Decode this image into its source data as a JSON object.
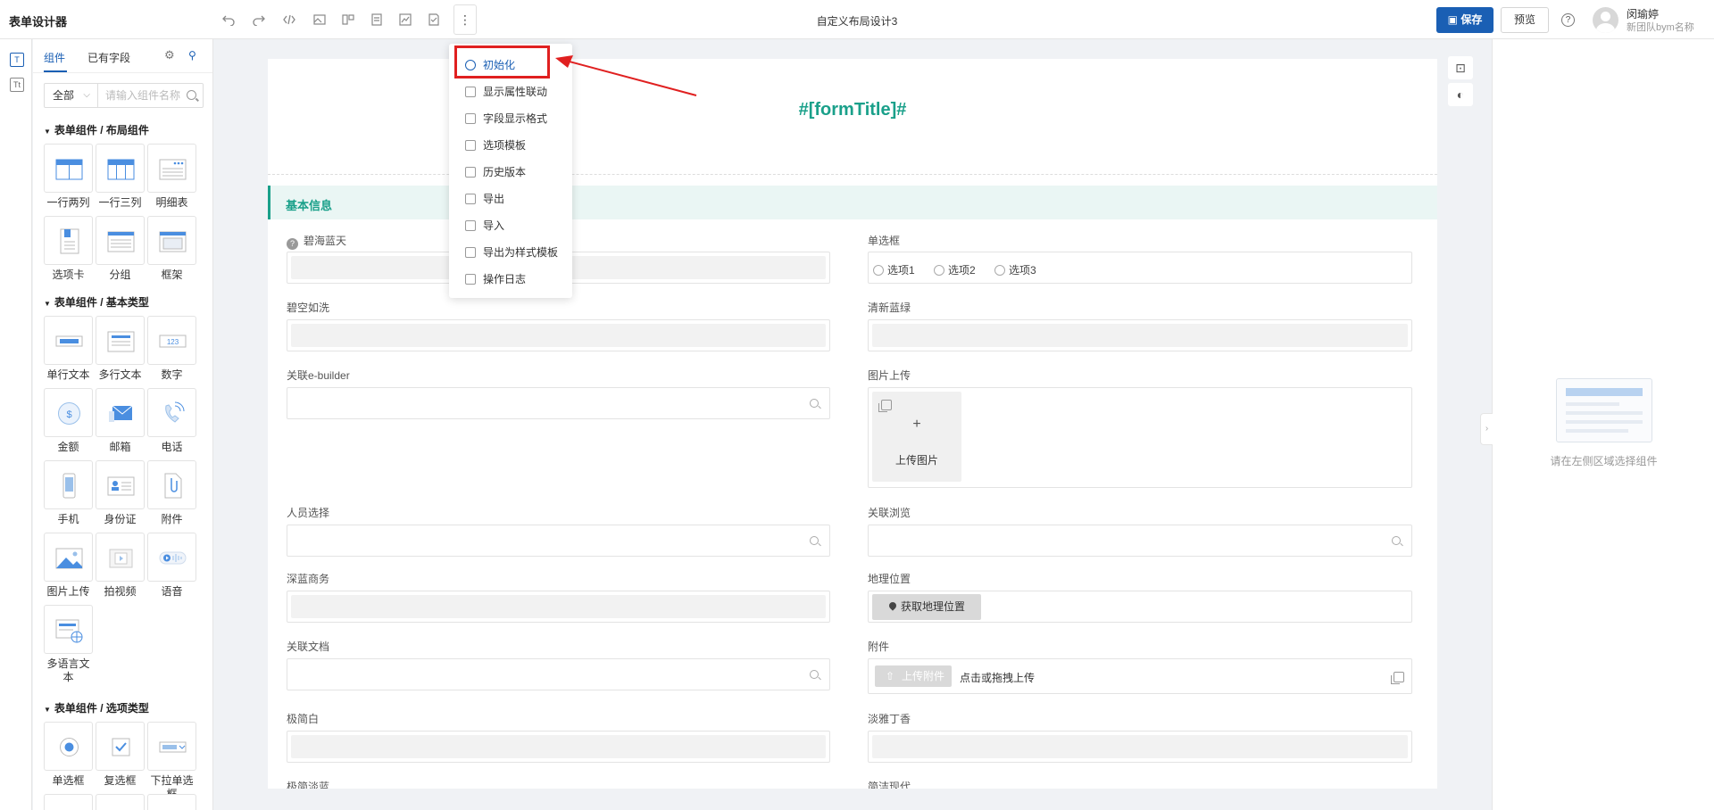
{
  "topbar": {
    "app_title": "表单设计器",
    "design_title": "自定义布局设计3",
    "save_label": "保存",
    "preview_label": "预览",
    "help": "?",
    "user_name": "闵瑜婷",
    "user_team": "新团队bym名称"
  },
  "sidebar": {
    "tab_components": "组件",
    "tab_fields": "已有字段",
    "filter_value": "全部",
    "search_placeholder": "请输入组件名称",
    "groups": [
      {
        "title": "表单组件 / 布局组件",
        "items": [
          "一行两列",
          "一行三列",
          "明细表",
          "选项卡",
          "分组",
          "框架"
        ]
      },
      {
        "title": "表单组件 / 基本类型",
        "items": [
          "单行文本",
          "多行文本",
          "数字",
          "金额",
          "邮箱",
          "电话",
          "手机",
          "身份证",
          "附件",
          "图片上传",
          "拍视频",
          "语音",
          "多语言文本"
        ]
      },
      {
        "title": "表单组件 / 选项类型",
        "items": [
          "单选框",
          "复选框",
          "下拉单选框"
        ]
      }
    ],
    "number_icon_text": "123"
  },
  "canvas": {
    "form_title": "#[formTitle]#",
    "section_title": "基本信息",
    "fields": {
      "f1": "碧海蓝天",
      "f2": "单选框",
      "f3": "碧空如洗",
      "f4": "清新蓝绿",
      "f5": "关联e-builder",
      "f6": "图片上传",
      "f7": "人员选择",
      "f8": "关联浏览",
      "f9": "深蓝商务",
      "f10": "地理位置",
      "f11": "关联文档",
      "f12": "附件",
      "f13": "极简白",
      "f14": "淡雅丁香",
      "f15": "极简淡蓝",
      "f16": "简洁现代"
    },
    "radio_options": [
      "选项1",
      "选项2",
      "选项3"
    ],
    "upload_plus": "+",
    "upload_text": "上传图片",
    "geo_button": "获取地理位置",
    "attach_button": "上传附件",
    "attach_hint": "点击或拖拽上传"
  },
  "menu": {
    "items": [
      "初始化",
      "显示属性联动",
      "字段显示格式",
      "选项模板",
      "历史版本",
      "导出",
      "导入",
      "导出为样式模板",
      "操作日志"
    ],
    "highlight_color": "#e02020"
  },
  "right_panel": {
    "empty_text": "请在左侧区域选择组件"
  },
  "colors": {
    "accent": "#1a5fb4",
    "theme": "#1aa08a",
    "annotation": "#e02020"
  }
}
